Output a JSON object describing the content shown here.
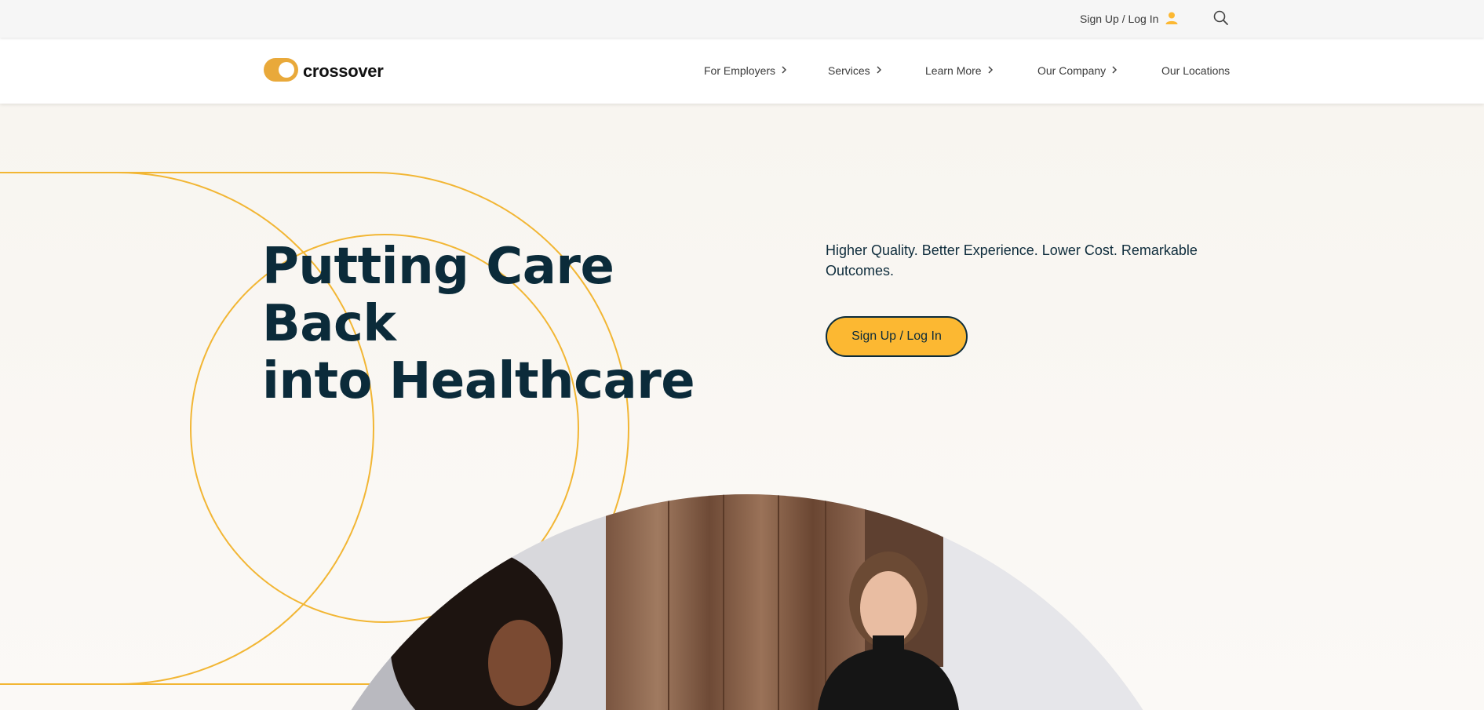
{
  "utility_bar": {
    "signup_label": "Sign Up / Log In",
    "user_icon": "user-icon",
    "search_icon": "search-icon"
  },
  "nav": {
    "logo_text": "crossover",
    "items": [
      {
        "label": "For Employers",
        "has_chevron": true
      },
      {
        "label": "Services",
        "has_chevron": true
      },
      {
        "label": "Learn More",
        "has_chevron": true
      },
      {
        "label": "Our Company",
        "has_chevron": true
      },
      {
        "label": "Our Locations",
        "has_chevron": false
      }
    ]
  },
  "hero": {
    "title_line1": "Putting Care Back",
    "title_line2": "into Healthcare",
    "subtitle": "Higher Quality. Better Experience. Lower Cost. Remarkable Outcomes.",
    "cta_label": "Sign Up / Log In",
    "photo_alt": "Clinician smiling and talking with a patient"
  },
  "colors": {
    "brand_yellow": "#fcb832",
    "navy": "#0b2b3a",
    "page_bg": "#fbf9f6"
  }
}
